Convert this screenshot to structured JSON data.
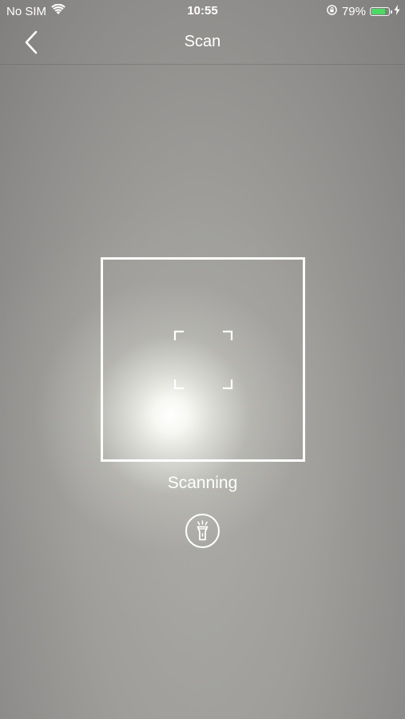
{
  "status_bar": {
    "carrier": "No SIM",
    "time": "10:55",
    "battery_percent": "79%",
    "battery_level": 0.79,
    "battery_color": "#4cd964",
    "icons": [
      "wifi-icon",
      "orientation-lock-icon",
      "battery-icon",
      "charging-bolt-icon"
    ]
  },
  "nav": {
    "title": "Scan",
    "back_icon": "chevron-left-icon"
  },
  "scanner": {
    "status_text": "Scanning",
    "frame_color": "#ffffff",
    "flashlight_icon": "flashlight-icon"
  }
}
